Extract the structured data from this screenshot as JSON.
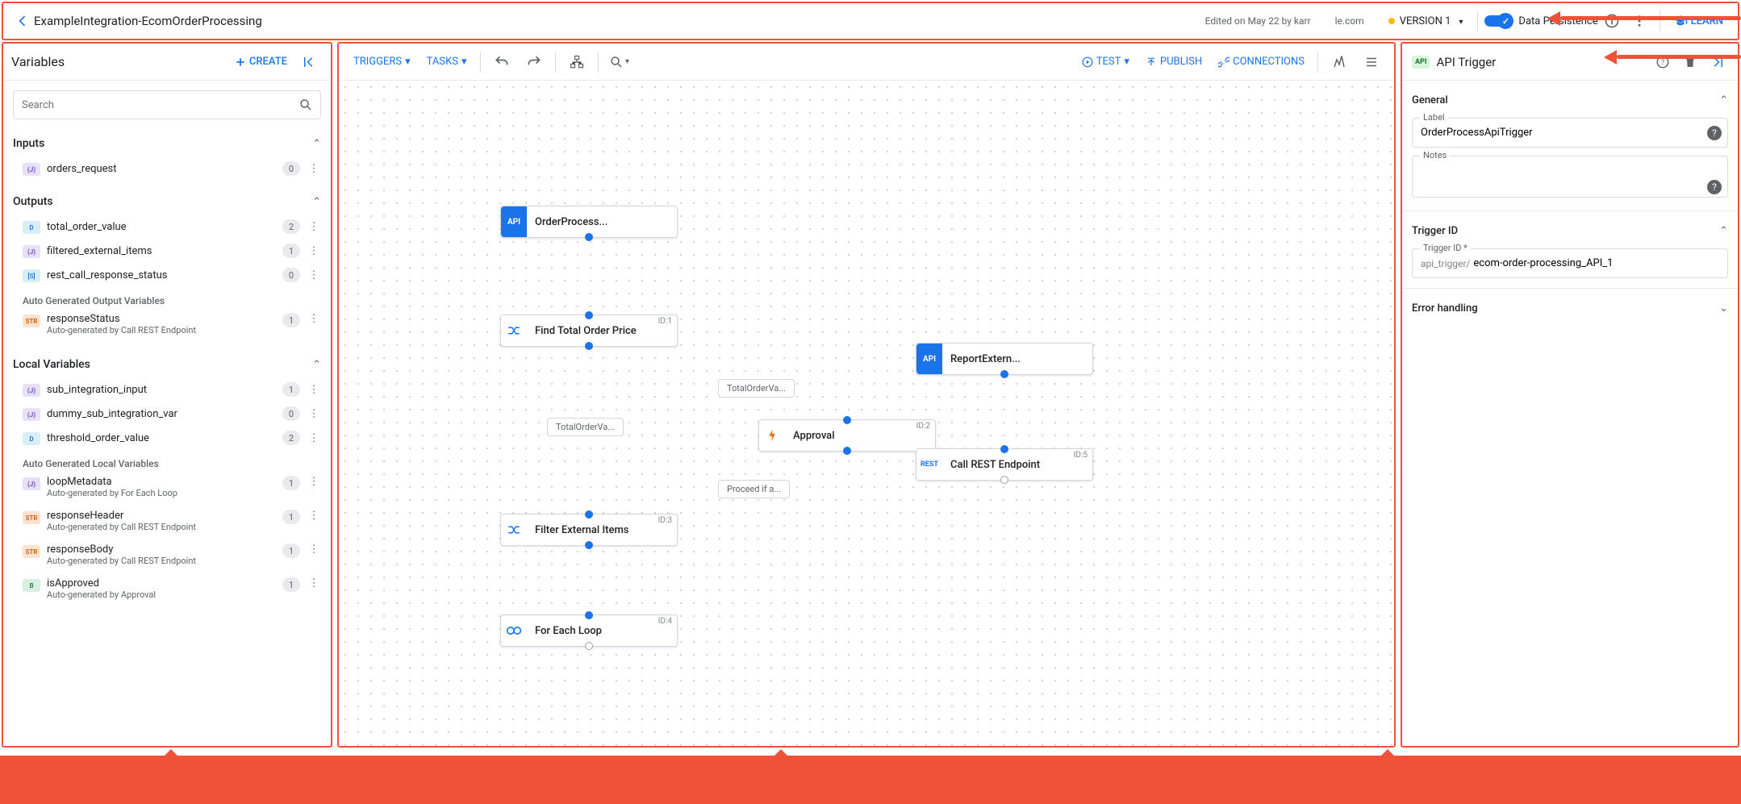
{
  "topbar": {
    "title": "ExampleIntegration-EcomOrderProcessing",
    "edited": "Edited on May 22 by karr",
    "org": "le.com",
    "version": "VERSION 1",
    "persistence": "Data Persistence",
    "learn": "LEARN"
  },
  "varPane": {
    "title": "Variables",
    "create": "CREATE",
    "search_ph": "Search",
    "sections": {
      "inputs": "Inputs",
      "outputs": "Outputs",
      "locals": "Local Variables"
    },
    "auto_out_lbl": "Auto Generated Output Variables",
    "auto_loc_lbl": "Auto Generated Local Variables",
    "inputs": [
      {
        "type": "(J)",
        "cls": "tb-j",
        "name": "orders_request",
        "count": "0"
      }
    ],
    "outputs": [
      {
        "type": "D",
        "cls": "tb-d",
        "name": "total_order_value",
        "count": "2"
      },
      {
        "type": "(J)",
        "cls": "tb-j",
        "name": "filtered_external_items",
        "count": "1"
      },
      {
        "type": "[S]",
        "cls": "tb-s",
        "name": "rest_call_response_status",
        "count": "0"
      }
    ],
    "outputs_auto": [
      {
        "type": "STR",
        "cls": "tb-str",
        "name": "responseStatus",
        "sub": "Auto-generated by Call REST Endpoint",
        "count": "1"
      }
    ],
    "locals": [
      {
        "type": "(J)",
        "cls": "tb-j",
        "name": "sub_integration_input",
        "count": "1"
      },
      {
        "type": "(J)",
        "cls": "tb-j",
        "name": "dummy_sub_integration_var",
        "count": "0"
      },
      {
        "type": "D",
        "cls": "tb-d",
        "name": "threshold_order_value",
        "count": "2"
      }
    ],
    "locals_auto": [
      {
        "type": "(J)",
        "cls": "tb-j",
        "name": "loopMetadata",
        "sub": "Auto-generated by For Each Loop",
        "count": "1"
      },
      {
        "type": "STR",
        "cls": "tb-str",
        "name": "responseHeader",
        "sub": "Auto-generated by Call REST Endpoint",
        "count": "1"
      },
      {
        "type": "STR",
        "cls": "tb-str",
        "name": "responseBody",
        "sub": "Auto-generated by Call REST Endpoint",
        "count": "1"
      },
      {
        "type": "B",
        "cls": "tb-b",
        "name": "isApproved",
        "sub": "Auto-generated by Approval",
        "count": "1"
      }
    ]
  },
  "toolbar": {
    "triggers": "TRIGGERS",
    "tasks": "TASKS",
    "test": "TEST",
    "publish": "PUBLISH",
    "connections": "CONNECTIONS"
  },
  "nodes": {
    "n1": {
      "label": "OrderProcess..."
    },
    "n2": {
      "label": "Find Total Order Price",
      "id": "ID:1"
    },
    "n3": {
      "label": "Approval",
      "id": "ID:2"
    },
    "n4": {
      "label": "Filter External Items",
      "id": "ID:3"
    },
    "n5": {
      "label": "For Each Loop",
      "id": "ID:4"
    },
    "n6": {
      "label": "ReportExtern..."
    },
    "n7": {
      "label": "Call REST Endpoint",
      "id": "ID:5"
    },
    "c1": "TotalOrderVa...",
    "c2": "TotalOrderVa...",
    "c3": "Proceed if a..."
  },
  "right": {
    "title": "API Trigger",
    "sec_general": "General",
    "label_lbl": "Label",
    "label_val": "OrderProcessApiTrigger",
    "notes_lbl": "Notes",
    "sec_trig": "Trigger ID",
    "trig_lbl": "Trigger ID *",
    "trig_pre": "api_trigger/",
    "trig_val": "ecom-order-processing_API_1",
    "sec_err": "Error handling"
  }
}
